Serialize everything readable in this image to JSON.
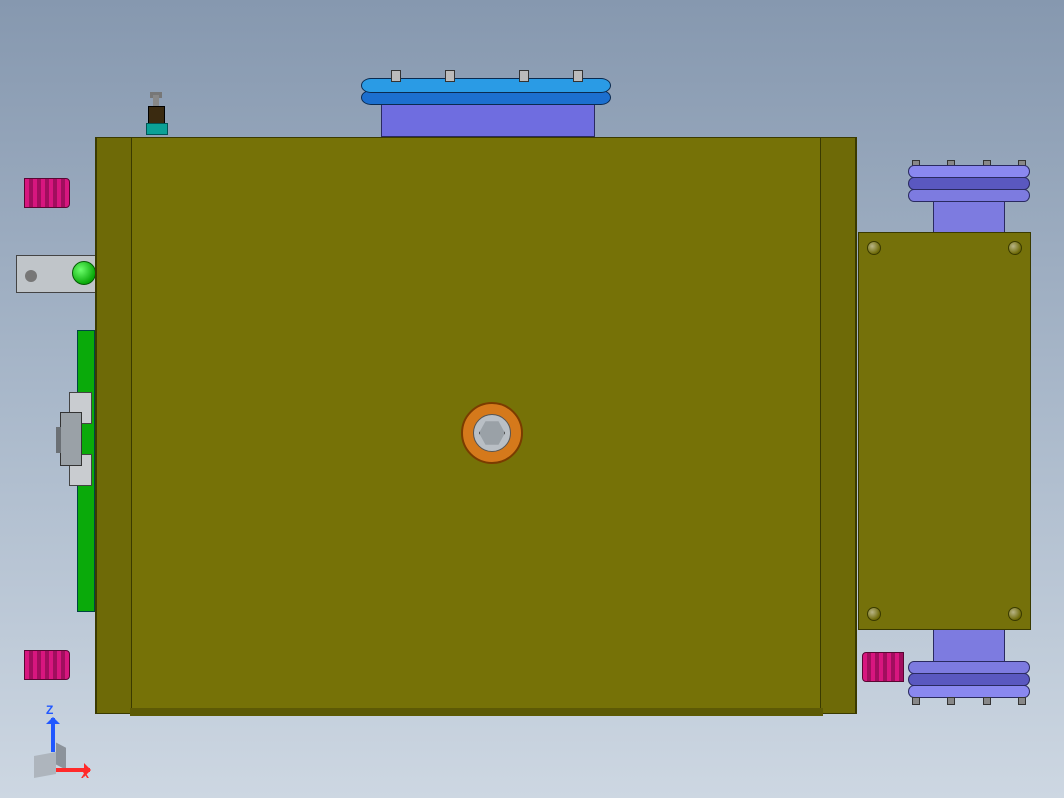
{
  "axes": {
    "z_label": "Z",
    "x_label": "X"
  },
  "parts": {
    "main_body": "main-chassis",
    "right_cover": "right-cover-plate",
    "top_flange": "top-inlet-flange",
    "right_flange_top": "right-flange-upper",
    "right_flange_bottom": "right-flange-lower",
    "center_port": "center-viewport",
    "left_port_top": "left-port-upper",
    "left_port_bottom": "left-port-lower",
    "sensor": "top-sensor",
    "bracket": "left-mount-bracket",
    "green_strip": "left-pcb-strip",
    "connector": "left-slot-connector"
  },
  "colors": {
    "body": "#767207",
    "flange_blue": "#1c6fcf",
    "flange_purple": "#7d7be0",
    "port_magenta": "#d8167f",
    "pcb_green": "#0aaa0a",
    "port_ring": "#d5791b"
  }
}
